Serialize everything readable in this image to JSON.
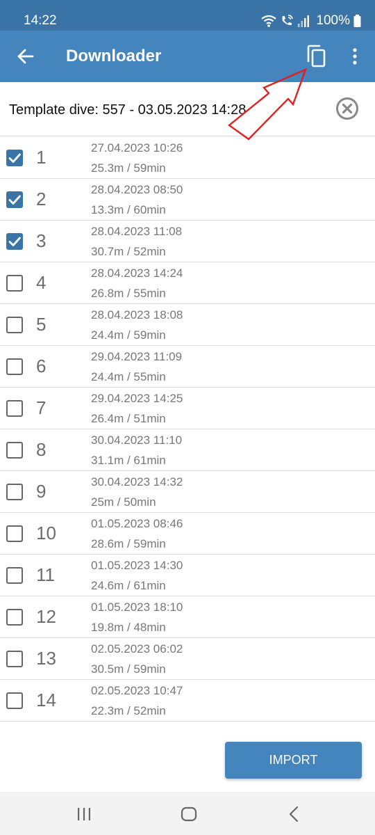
{
  "status_bar": {
    "time": "14:22",
    "battery": "100%",
    "icons": [
      "wifi-icon",
      "wifi-calling-icon",
      "signal-icon",
      "battery-icon"
    ]
  },
  "app_bar": {
    "title": "Downloader",
    "icons": [
      "back-arrow-icon",
      "copy-icon",
      "more-vert-icon"
    ],
    "color": "#4585bd"
  },
  "template": {
    "label": "Template dive: 557 - 03.05.2023 14:28",
    "clear_icon": "close-circle-icon"
  },
  "dives": [
    {
      "num": "1",
      "date": "27.04.2023 10:26",
      "stats": "25.3m / 59min",
      "checked": true
    },
    {
      "num": "2",
      "date": "28.04.2023 08:50",
      "stats": "13.3m / 60min",
      "checked": true
    },
    {
      "num": "3",
      "date": "28.04.2023 11:08",
      "stats": "30.7m / 52min",
      "checked": true
    },
    {
      "num": "4",
      "date": "28.04.2023 14:24",
      "stats": "26.8m / 55min",
      "checked": false
    },
    {
      "num": "5",
      "date": "28.04.2023 18:08",
      "stats": "24.4m / 59min",
      "checked": false
    },
    {
      "num": "6",
      "date": "29.04.2023 11:09",
      "stats": "24.4m / 55min",
      "checked": false
    },
    {
      "num": "7",
      "date": "29.04.2023 14:25",
      "stats": "26.4m / 51min",
      "checked": false
    },
    {
      "num": "8",
      "date": "30.04.2023 11:10",
      "stats": "31.1m / 61min",
      "checked": false
    },
    {
      "num": "9",
      "date": "30.04.2023 14:32",
      "stats": "25m / 50min",
      "checked": false
    },
    {
      "num": "10",
      "date": "01.05.2023 08:46",
      "stats": "28.6m / 59min",
      "checked": false
    },
    {
      "num": "11",
      "date": "01.05.2023 14:30",
      "stats": "24.6m / 61min",
      "checked": false
    },
    {
      "num": "12",
      "date": "01.05.2023 18:10",
      "stats": "19.8m / 48min",
      "checked": false
    },
    {
      "num": "13",
      "date": "02.05.2023 06:02",
      "stats": "30.5m / 59min",
      "checked": false
    },
    {
      "num": "14",
      "date": "02.05.2023 10:47",
      "stats": "22.3m / 52min",
      "checked": false
    }
  ],
  "import_label": "IMPORT",
  "nav_bar": {
    "icons": [
      "recents-icon",
      "home-icon",
      "back-chevron-icon"
    ]
  },
  "colors": {
    "status_bar": "#3a73a5",
    "accent": "#4585bd",
    "annotation": "#e02020"
  }
}
